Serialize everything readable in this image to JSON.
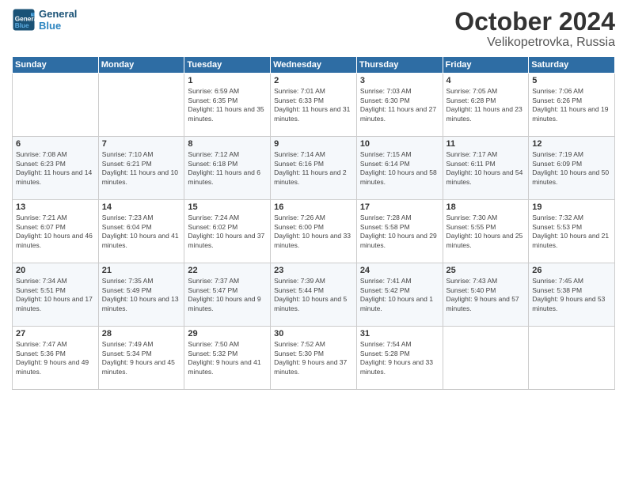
{
  "header": {
    "logo_line1": "General",
    "logo_line2": "Blue",
    "month": "October 2024",
    "location": "Velikopetrovka, Russia"
  },
  "weekdays": [
    "Sunday",
    "Monday",
    "Tuesday",
    "Wednesday",
    "Thursday",
    "Friday",
    "Saturday"
  ],
  "weeks": [
    [
      {
        "day": "",
        "content": ""
      },
      {
        "day": "",
        "content": ""
      },
      {
        "day": "1",
        "content": "Sunrise: 6:59 AM\nSunset: 6:35 PM\nDaylight: 11 hours and 35 minutes."
      },
      {
        "day": "2",
        "content": "Sunrise: 7:01 AM\nSunset: 6:33 PM\nDaylight: 11 hours and 31 minutes."
      },
      {
        "day": "3",
        "content": "Sunrise: 7:03 AM\nSunset: 6:30 PM\nDaylight: 11 hours and 27 minutes."
      },
      {
        "day": "4",
        "content": "Sunrise: 7:05 AM\nSunset: 6:28 PM\nDaylight: 11 hours and 23 minutes."
      },
      {
        "day": "5",
        "content": "Sunrise: 7:06 AM\nSunset: 6:26 PM\nDaylight: 11 hours and 19 minutes."
      }
    ],
    [
      {
        "day": "6",
        "content": "Sunrise: 7:08 AM\nSunset: 6:23 PM\nDaylight: 11 hours and 14 minutes."
      },
      {
        "day": "7",
        "content": "Sunrise: 7:10 AM\nSunset: 6:21 PM\nDaylight: 11 hours and 10 minutes."
      },
      {
        "day": "8",
        "content": "Sunrise: 7:12 AM\nSunset: 6:18 PM\nDaylight: 11 hours and 6 minutes."
      },
      {
        "day": "9",
        "content": "Sunrise: 7:14 AM\nSunset: 6:16 PM\nDaylight: 11 hours and 2 minutes."
      },
      {
        "day": "10",
        "content": "Sunrise: 7:15 AM\nSunset: 6:14 PM\nDaylight: 10 hours and 58 minutes."
      },
      {
        "day": "11",
        "content": "Sunrise: 7:17 AM\nSunset: 6:11 PM\nDaylight: 10 hours and 54 minutes."
      },
      {
        "day": "12",
        "content": "Sunrise: 7:19 AM\nSunset: 6:09 PM\nDaylight: 10 hours and 50 minutes."
      }
    ],
    [
      {
        "day": "13",
        "content": "Sunrise: 7:21 AM\nSunset: 6:07 PM\nDaylight: 10 hours and 46 minutes."
      },
      {
        "day": "14",
        "content": "Sunrise: 7:23 AM\nSunset: 6:04 PM\nDaylight: 10 hours and 41 minutes."
      },
      {
        "day": "15",
        "content": "Sunrise: 7:24 AM\nSunset: 6:02 PM\nDaylight: 10 hours and 37 minutes."
      },
      {
        "day": "16",
        "content": "Sunrise: 7:26 AM\nSunset: 6:00 PM\nDaylight: 10 hours and 33 minutes."
      },
      {
        "day": "17",
        "content": "Sunrise: 7:28 AM\nSunset: 5:58 PM\nDaylight: 10 hours and 29 minutes."
      },
      {
        "day": "18",
        "content": "Sunrise: 7:30 AM\nSunset: 5:55 PM\nDaylight: 10 hours and 25 minutes."
      },
      {
        "day": "19",
        "content": "Sunrise: 7:32 AM\nSunset: 5:53 PM\nDaylight: 10 hours and 21 minutes."
      }
    ],
    [
      {
        "day": "20",
        "content": "Sunrise: 7:34 AM\nSunset: 5:51 PM\nDaylight: 10 hours and 17 minutes."
      },
      {
        "day": "21",
        "content": "Sunrise: 7:35 AM\nSunset: 5:49 PM\nDaylight: 10 hours and 13 minutes."
      },
      {
        "day": "22",
        "content": "Sunrise: 7:37 AM\nSunset: 5:47 PM\nDaylight: 10 hours and 9 minutes."
      },
      {
        "day": "23",
        "content": "Sunrise: 7:39 AM\nSunset: 5:44 PM\nDaylight: 10 hours and 5 minutes."
      },
      {
        "day": "24",
        "content": "Sunrise: 7:41 AM\nSunset: 5:42 PM\nDaylight: 10 hours and 1 minute."
      },
      {
        "day": "25",
        "content": "Sunrise: 7:43 AM\nSunset: 5:40 PM\nDaylight: 9 hours and 57 minutes."
      },
      {
        "day": "26",
        "content": "Sunrise: 7:45 AM\nSunset: 5:38 PM\nDaylight: 9 hours and 53 minutes."
      }
    ],
    [
      {
        "day": "27",
        "content": "Sunrise: 7:47 AM\nSunset: 5:36 PM\nDaylight: 9 hours and 49 minutes."
      },
      {
        "day": "28",
        "content": "Sunrise: 7:49 AM\nSunset: 5:34 PM\nDaylight: 9 hours and 45 minutes."
      },
      {
        "day": "29",
        "content": "Sunrise: 7:50 AM\nSunset: 5:32 PM\nDaylight: 9 hours and 41 minutes."
      },
      {
        "day": "30",
        "content": "Sunrise: 7:52 AM\nSunset: 5:30 PM\nDaylight: 9 hours and 37 minutes."
      },
      {
        "day": "31",
        "content": "Sunrise: 7:54 AM\nSunset: 5:28 PM\nDaylight: 9 hours and 33 minutes."
      },
      {
        "day": "",
        "content": ""
      },
      {
        "day": "",
        "content": ""
      }
    ]
  ]
}
